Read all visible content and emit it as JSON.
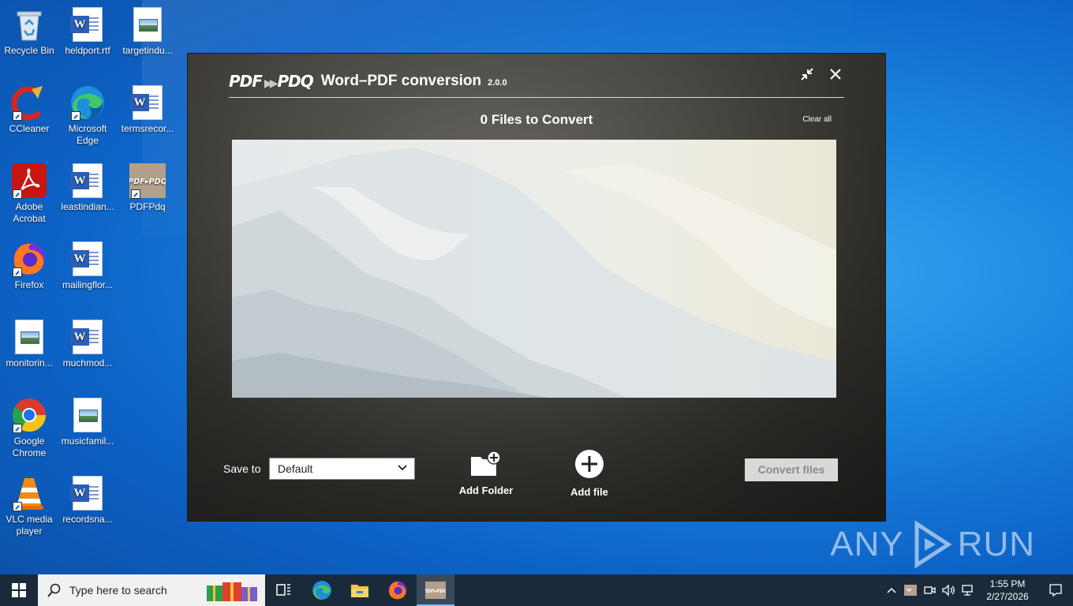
{
  "desktop": {
    "icons": [
      {
        "label": "Recycle Bin",
        "icon": "recycle-bin-icon"
      },
      {
        "label": "heldport.rtf",
        "icon": "word-document-icon"
      },
      {
        "label": "targetindu...",
        "icon": "image-file-icon"
      },
      {
        "label": "CCleaner",
        "icon": "ccleaner-icon"
      },
      {
        "label": "Microsoft Edge",
        "icon": "edge-icon"
      },
      {
        "label": "termsrecor...",
        "icon": "word-document-icon"
      },
      {
        "label": "Adobe Acrobat",
        "icon": "adobe-acrobat-icon"
      },
      {
        "label": "leastindian...",
        "icon": "word-document-icon"
      },
      {
        "label": "PDFPdq",
        "icon": "pdfpdq-icon"
      },
      {
        "label": "Firefox",
        "icon": "firefox-icon"
      },
      {
        "label": "mailingflor...",
        "icon": "word-document-icon"
      },
      {
        "label": "monitorin...",
        "icon": "image-file-icon"
      },
      {
        "label": "muchmod...",
        "icon": "word-document-icon"
      },
      {
        "label": "Google Chrome",
        "icon": "chrome-icon"
      },
      {
        "label": "musicfamil...",
        "icon": "image-file-icon"
      },
      {
        "label": "VLC media player",
        "icon": "vlc-icon"
      },
      {
        "label": "recordsna...",
        "icon": "word-document-icon"
      }
    ]
  },
  "app": {
    "brand": "PDF",
    "brand2": "PDQ",
    "title": "Word–PDF conversion",
    "version": "2.0.0",
    "files_count": "0 Files to Convert",
    "clear_all": "Clear all",
    "save_to_label": "Save to",
    "save_to_value": "Default",
    "add_folder": "Add Folder",
    "add_file": "Add file",
    "convert": "Convert files"
  },
  "taskbar": {
    "search_placeholder": "Type here to search",
    "time": "1:55 PM",
    "date": "2/27/2026"
  },
  "watermark": {
    "left": "ANY",
    "right": "RUN"
  }
}
